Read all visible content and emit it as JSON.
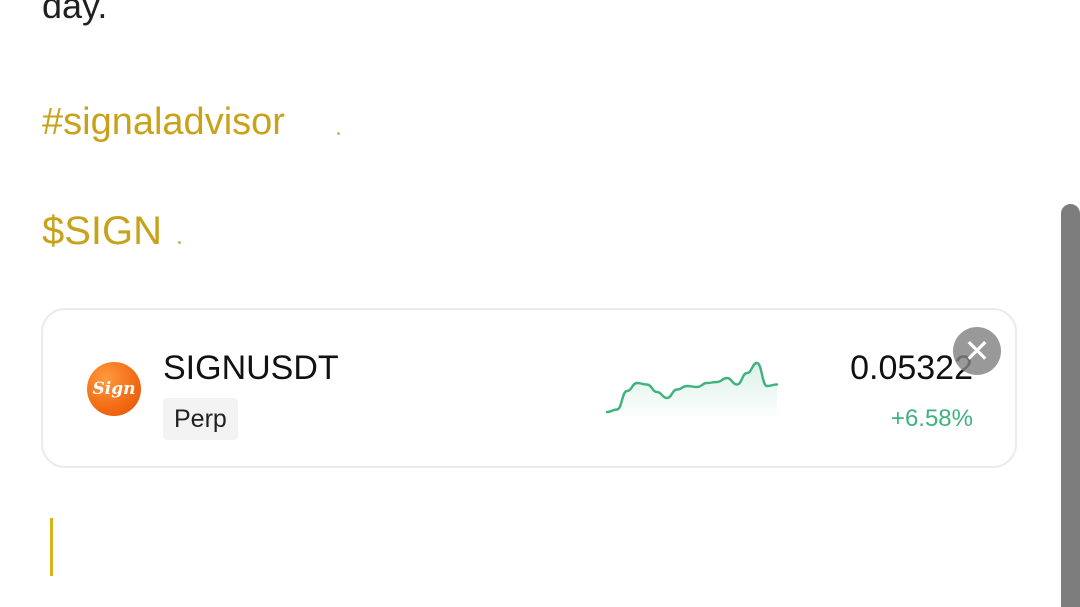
{
  "post": {
    "text_tail": "day.",
    "hashtag": "#signaladvisor",
    "cashtag": "$SIGN"
  },
  "ticker_card": {
    "logo_text": "Sign",
    "symbol": "SIGNUSDT",
    "badge": "Perp",
    "price": "0.05322",
    "change": "+6.58%",
    "change_color": "#3fb27f",
    "sparkline": [
      0.0,
      0.05,
      0.42,
      0.58,
      0.55,
      0.4,
      0.28,
      0.45,
      0.52,
      0.5,
      0.58,
      0.6,
      0.68,
      0.55,
      0.78,
      0.98,
      0.52,
      0.55
    ],
    "close_label": "✕"
  },
  "colors": {
    "accent": "#c9a21c",
    "text": "#111111",
    "positive": "#3fb27f"
  }
}
